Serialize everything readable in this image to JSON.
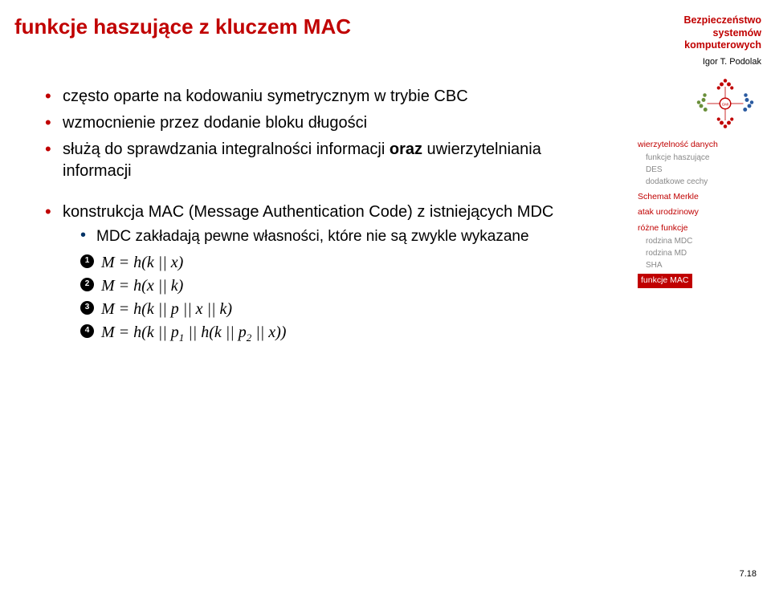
{
  "header": {
    "title": "funkcje haszujące z kluczem MAC",
    "course_line1": "Bezpieczeństwo",
    "course_line2": "systemów",
    "course_line3": "komputerowych",
    "author": "Igor T. Podolak"
  },
  "bullets": {
    "b1": "często oparte na kodowaniu symetrycznym w trybie CBC",
    "b2": "wzmocnienie przez dodanie bloku długości",
    "b3_pre": "służą do sprawdzania integralności informacji ",
    "b3_bold": "oraz",
    "b3_post": " uwierzytelniania informacji",
    "b4": "konstrukcja MAC (Message Authentication Code) z istniejących MDC",
    "b4_sub": "MDC zakładają pewne własności, które nie są zwykle wykazane",
    "eq1": "M = h(k || x)",
    "eq2": "M = h(x || k)",
    "eq3": "M = h(k || p || x || k)",
    "eq4_a": "M = h(k || p",
    "eq4_b": " || h(k || p",
    "eq4_c": " || x))"
  },
  "toc": {
    "i1": "wierzytelność danych",
    "i1a": "funkcje haszujące",
    "i1b": "DES",
    "i1c": "dodatkowe cechy",
    "i2": "Schemat Merkle",
    "i3": "atak urodzinowy",
    "i4": "różne funkcje",
    "i4a": "rodzina MDC",
    "i4b": "rodzina MD",
    "i4c": "SHA",
    "active": "funkcje MAC"
  },
  "pagenum": "7.18"
}
